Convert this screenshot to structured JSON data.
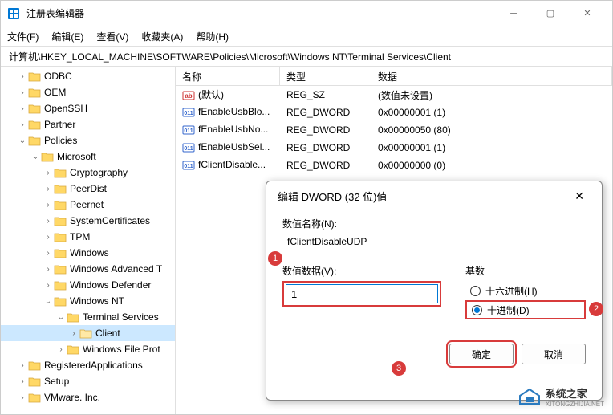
{
  "window": {
    "title": "注册表编辑器"
  },
  "menu": {
    "file": "文件(F)",
    "edit": "编辑(E)",
    "view": "查看(V)",
    "favorites": "收藏夹(A)",
    "help": "帮助(H)"
  },
  "address": "计算机\\HKEY_LOCAL_MACHINE\\SOFTWARE\\Policies\\Microsoft\\Windows NT\\Terminal Services\\Client",
  "tree": {
    "items": [
      {
        "label": "ODBC",
        "indent": 1,
        "chev": ">"
      },
      {
        "label": "OEM",
        "indent": 1,
        "chev": ">"
      },
      {
        "label": "OpenSSH",
        "indent": 1,
        "chev": ">"
      },
      {
        "label": "Partner",
        "indent": 1,
        "chev": ">"
      },
      {
        "label": "Policies",
        "indent": 1,
        "chev": "v"
      },
      {
        "label": "Microsoft",
        "indent": 2,
        "chev": "v"
      },
      {
        "label": "Cryptography",
        "indent": 3,
        "chev": ">"
      },
      {
        "label": "PeerDist",
        "indent": 3,
        "chev": ">"
      },
      {
        "label": "Peernet",
        "indent": 3,
        "chev": ">"
      },
      {
        "label": "SystemCertificates",
        "indent": 3,
        "chev": ">"
      },
      {
        "label": "TPM",
        "indent": 3,
        "chev": ">"
      },
      {
        "label": "Windows",
        "indent": 3,
        "chev": ">"
      },
      {
        "label": "Windows Advanced T",
        "indent": 3,
        "chev": ">"
      },
      {
        "label": "Windows Defender",
        "indent": 3,
        "chev": ">"
      },
      {
        "label": "Windows NT",
        "indent": 3,
        "chev": "v"
      },
      {
        "label": "Terminal Services",
        "indent": 4,
        "chev": "v"
      },
      {
        "label": "Client",
        "indent": 5,
        "chev": ">",
        "selected": true,
        "open": true
      },
      {
        "label": "Windows File Prot",
        "indent": 4,
        "chev": ">"
      },
      {
        "label": "RegisteredApplications",
        "indent": 1,
        "chev": ">"
      },
      {
        "label": "Setup",
        "indent": 1,
        "chev": ">"
      },
      {
        "label": "VMware. Inc.",
        "indent": 1,
        "chev": ">"
      }
    ]
  },
  "list": {
    "headers": {
      "name": "名称",
      "type": "类型",
      "data": "数据"
    },
    "rows": [
      {
        "icon": "ab",
        "name": "(默认)",
        "type": "REG_SZ",
        "data": "(数值未设置)"
      },
      {
        "icon": "bin",
        "name": "fEnableUsbBlo...",
        "type": "REG_DWORD",
        "data": "0x00000001 (1)"
      },
      {
        "icon": "bin",
        "name": "fEnableUsbNo...",
        "type": "REG_DWORD",
        "data": "0x00000050 (80)"
      },
      {
        "icon": "bin",
        "name": "fEnableUsbSel...",
        "type": "REG_DWORD",
        "data": "0x00000001 (1)"
      },
      {
        "icon": "bin",
        "name": "fClientDisable...",
        "type": "REG_DWORD",
        "data": "0x00000000 (0)"
      }
    ]
  },
  "dialog": {
    "title": "编辑 DWORD (32 位)值",
    "name_label": "数值名称(N):",
    "name_value": "fClientDisableUDP",
    "data_label": "数值数据(V):",
    "data_value": "1",
    "base_label": "基数",
    "hex_label": "十六进制(H)",
    "dec_label": "十进制(D)",
    "ok": "确定",
    "cancel": "取消"
  },
  "badges": {
    "b1": "1",
    "b2": "2",
    "b3": "3"
  },
  "watermark": {
    "name": "系统之家",
    "url": "XITONGZHIJIA.NET"
  }
}
